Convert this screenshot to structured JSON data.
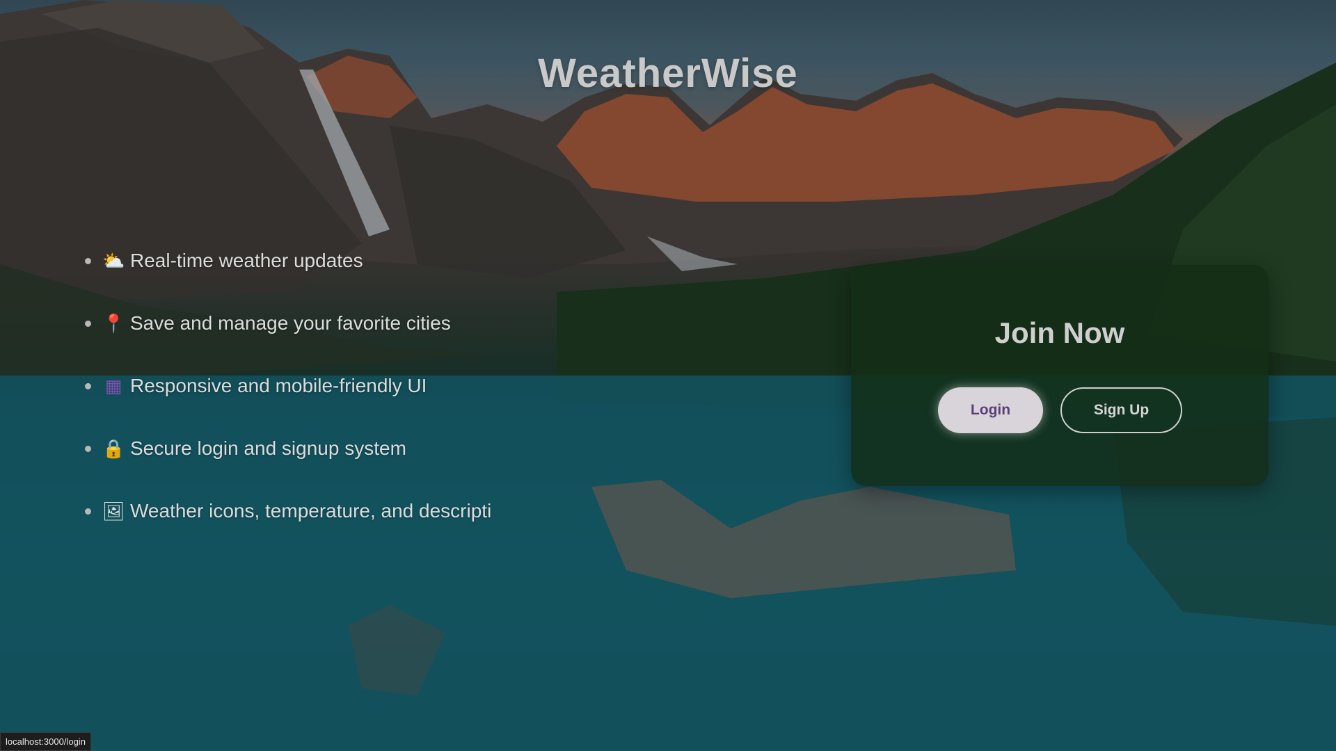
{
  "app": {
    "title": "WeatherWise"
  },
  "features": [
    {
      "icon": "cloud-sun-icon",
      "glyph": "⛅",
      "text": "Real-time weather updates"
    },
    {
      "icon": "pin-icon",
      "glyph": "📍",
      "text": "Save and manage your favorite cities"
    },
    {
      "icon": "grid-icon",
      "glyph": "▦",
      "text": "Responsive and mobile-friendly UI"
    },
    {
      "icon": "lock-icon",
      "glyph": "🔒",
      "text": "Secure login and signup system"
    },
    {
      "icon": "picture-icon",
      "glyph": "🖼",
      "text": "Weather icons, temperature, and descripti"
    }
  ],
  "join": {
    "title": "Join Now",
    "login_label": "Login",
    "signup_label": "Sign Up"
  },
  "status": {
    "url": "localhost:3000/login"
  },
  "colors": {
    "card_bg": "#142d16",
    "login_bg": "#d9d4da",
    "login_text": "#5a3f7a",
    "title_text": "#c9c9c9"
  }
}
